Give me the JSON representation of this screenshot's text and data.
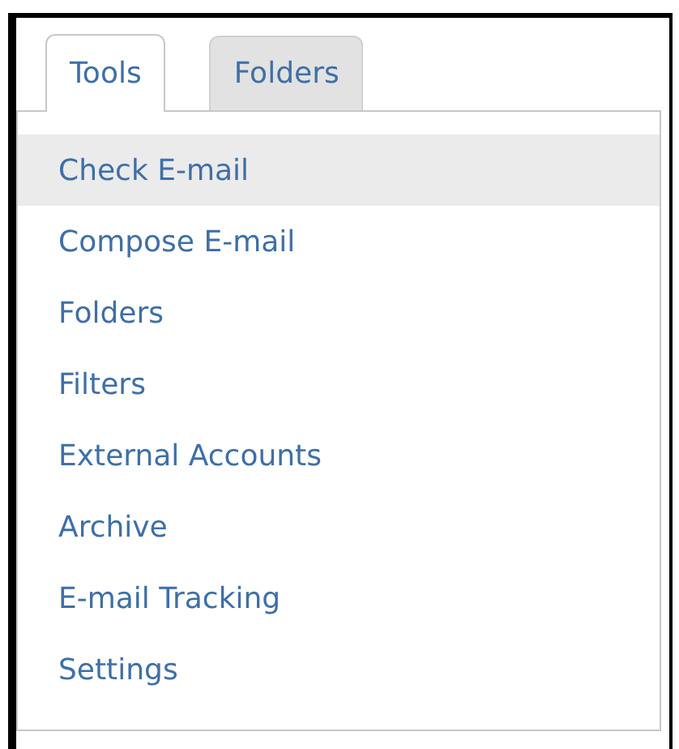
{
  "tabs": [
    {
      "label": "Tools",
      "selected": true
    },
    {
      "label": "Folders",
      "selected": false
    }
  ],
  "menu": [
    {
      "label": "Check E-mail",
      "selected": true
    },
    {
      "label": "Compose E-mail",
      "selected": false
    },
    {
      "label": "Folders",
      "selected": false
    },
    {
      "label": "Filters",
      "selected": false
    },
    {
      "label": "External Accounts",
      "selected": false
    },
    {
      "label": "Archive",
      "selected": false
    },
    {
      "label": "E-mail Tracking",
      "selected": false
    },
    {
      "label": "Settings",
      "selected": false
    }
  ]
}
